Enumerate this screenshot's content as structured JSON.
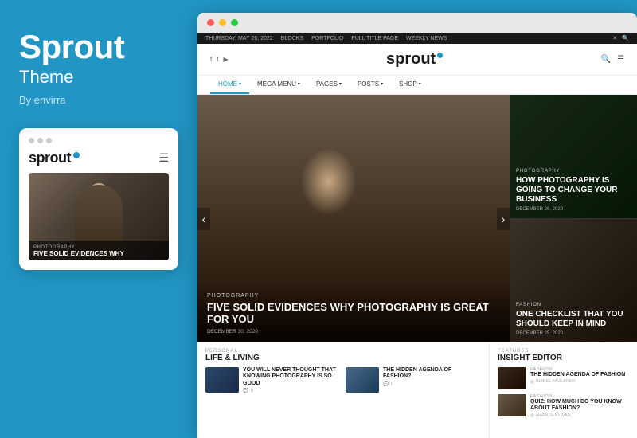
{
  "left": {
    "brand_title": "Sprout",
    "brand_subtitle": "Theme",
    "brand_by": "By envirra",
    "mobile": {
      "logo": "sprout",
      "hero_cat": "PHOTOGRAPHY",
      "hero_title": "FIVE SOLID EVIDENCES WHY"
    }
  },
  "browser": {
    "topbar": {
      "date": "THURSDAY, MAY 26, 2022",
      "links": [
        "BLOCKS",
        "PORTFOLIO",
        "FULL TITLE PAGE",
        "WEEKLY NEWS"
      ]
    },
    "header": {
      "logo": "sprout",
      "social": [
        "f",
        "t",
        "y"
      ]
    },
    "nav": {
      "items": [
        {
          "label": "HOME",
          "active": true
        },
        {
          "label": "MEGA MENU"
        },
        {
          "label": "PAGES"
        },
        {
          "label": "POSTS"
        },
        {
          "label": "SHOP"
        }
      ]
    },
    "hero_main": {
      "category": "PHOTOGRAPHY",
      "title": "FIVE SOLID EVIDENCES WHY PHOTOGRAPHY IS GREAT FOR YOU",
      "date": "DECEMBER 30, 2020"
    },
    "hero_card_top": {
      "category": "PHOTOGRAPHY",
      "title": "HOW PHOTOGRAPHY IS GOING TO CHANGE YOUR BUSINESS",
      "date": "DECEMBER 26, 2020"
    },
    "hero_card_bottom": {
      "category": "FASHION",
      "title": "ONE CHECKLIST THAT YOU SHOULD KEEP IN MIND",
      "date": "DECEMBER 25, 2020"
    },
    "life_section": {
      "label": "PERSONAL",
      "title": "LIFE & LIVING"
    },
    "articles": [
      {
        "img_class": "img-camping",
        "title": "YOU WILL NEVER THOUGHT THAT KNOWING PHOTOGRAPHY IS SO GOOD",
        "comments": "0"
      },
      {
        "img_class": "img-mountain",
        "title": "THE HIDDEN AGENDA OF FASHION?",
        "comments": "0"
      }
    ],
    "insight_section": {
      "label": "FEATURES",
      "title": "INSIGHT EDITOR"
    },
    "insight_articles": [
      {
        "img_class": "img-dark",
        "category": "FASHION",
        "title": "THE HIDDEN AGENDA OF FASHION",
        "author": "ISABEL FAULKNER"
      },
      {
        "img_class": "img-fashion",
        "category": "FASHION",
        "title": "QUIZ: HOW MUCH DO YOU KNOW ABOUT FASHION?",
        "author": "MARK SULLIVAN"
      }
    ]
  }
}
